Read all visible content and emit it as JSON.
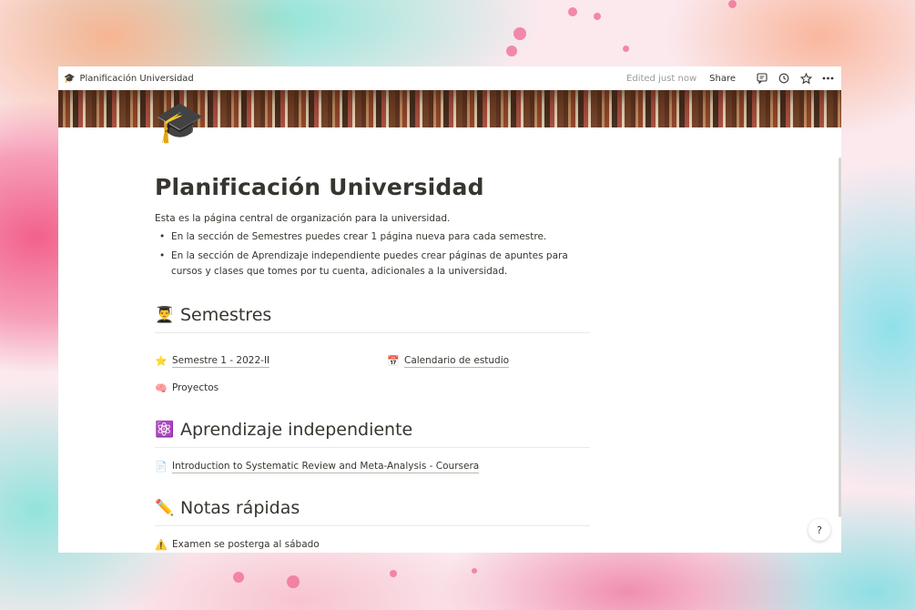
{
  "app": {
    "breadcrumb": "Planificación Universidad",
    "edited": "Edited just now",
    "share": "Share",
    "icons": [
      "comment-icon",
      "history-icon",
      "star-icon",
      "more-icon"
    ]
  },
  "page": {
    "icon": "🎓",
    "title": "Planificación Universidad",
    "intro": "Esta es la página central de organización para la universidad.",
    "bullets": [
      "En la sección de Semestres puedes crear 1 página nueva para cada semestre.",
      "En la sección de Aprendizaje independiente puedes crear páginas de apuntes para cursos y clases que tomes por tu cuenta, adicionales a la universidad."
    ]
  },
  "sections": {
    "semestres": {
      "emoji": "👨‍🎓",
      "heading": "Semestres",
      "links": [
        {
          "emoji": "⭐",
          "label": "Semestre 1 - 2022-II"
        },
        {
          "emoji": "📅",
          "label": "Calendario de estudio"
        },
        {
          "emoji": "🧠",
          "label": "Proyectos"
        }
      ]
    },
    "aprendizaje": {
      "emoji": "⚛️",
      "heading": "Aprendizaje independiente",
      "links": [
        {
          "emoji": "📄",
          "label": "Introduction to Systematic Review and Meta-Analysis - Coursera"
        }
      ]
    },
    "notas": {
      "emoji": "✏️",
      "heading": "Notas rápidas",
      "items": [
        {
          "emoji": "⚠️",
          "label": "Examen se posterga al sábado"
        }
      ]
    }
  },
  "help": "?"
}
